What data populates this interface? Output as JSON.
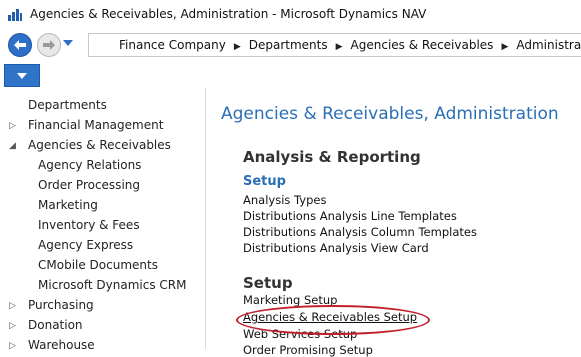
{
  "window": {
    "title": "Agencies & Receivables, Administration - Microsoft Dynamics NAV"
  },
  "icons": {
    "app": "dynamics-nav-icon",
    "back": "back-arrow-icon",
    "forward": "forward-arrow-icon",
    "history": "chevron-down-icon",
    "menu": "menu-dropdown-icon",
    "breadcrumb_separator": "triangle-right-icon"
  },
  "colors": {
    "accent": "#2a6fb5",
    "nav_button": "#2e6fc8",
    "highlight": "#c0202a"
  },
  "breadcrumb": [
    "Finance Company",
    "Departments",
    "Agencies & Receivables",
    "Administration"
  ],
  "sidebar": {
    "items": [
      {
        "label": "Departments",
        "level": 0,
        "state": "none"
      },
      {
        "label": "Financial Management",
        "level": 0,
        "state": "collapsed"
      },
      {
        "label": "Agencies & Receivables",
        "level": 0,
        "state": "expanded"
      },
      {
        "label": "Agency Relations",
        "level": 1,
        "state": "none"
      },
      {
        "label": "Order Processing",
        "level": 1,
        "state": "none"
      },
      {
        "label": "Marketing",
        "level": 1,
        "state": "none"
      },
      {
        "label": "Inventory & Fees",
        "level": 1,
        "state": "none"
      },
      {
        "label": "Agency Express",
        "level": 1,
        "state": "none"
      },
      {
        "label": "CMobile Documents",
        "level": 1,
        "state": "none"
      },
      {
        "label": "Microsoft Dynamics CRM",
        "level": 1,
        "state": "none"
      },
      {
        "label": "Purchasing",
        "level": 0,
        "state": "collapsed"
      },
      {
        "label": "Donation",
        "level": 0,
        "state": "collapsed"
      },
      {
        "label": "Warehouse",
        "level": 0,
        "state": "collapsed"
      }
    ]
  },
  "main": {
    "title": "Agencies & Receivables, Administration",
    "sections": [
      {
        "title": "Analysis & Reporting",
        "group": "Setup",
        "links": [
          "Analysis Types",
          "Distributions Analysis Line Templates",
          "Distributions Analysis Column Templates",
          "Distributions Analysis View Card"
        ]
      },
      {
        "title": "Setup",
        "links": [
          "Marketing Setup",
          "Agencies & Receivables Setup",
          "Web Services Setup",
          "Order Promising Setup"
        ]
      }
    ]
  }
}
